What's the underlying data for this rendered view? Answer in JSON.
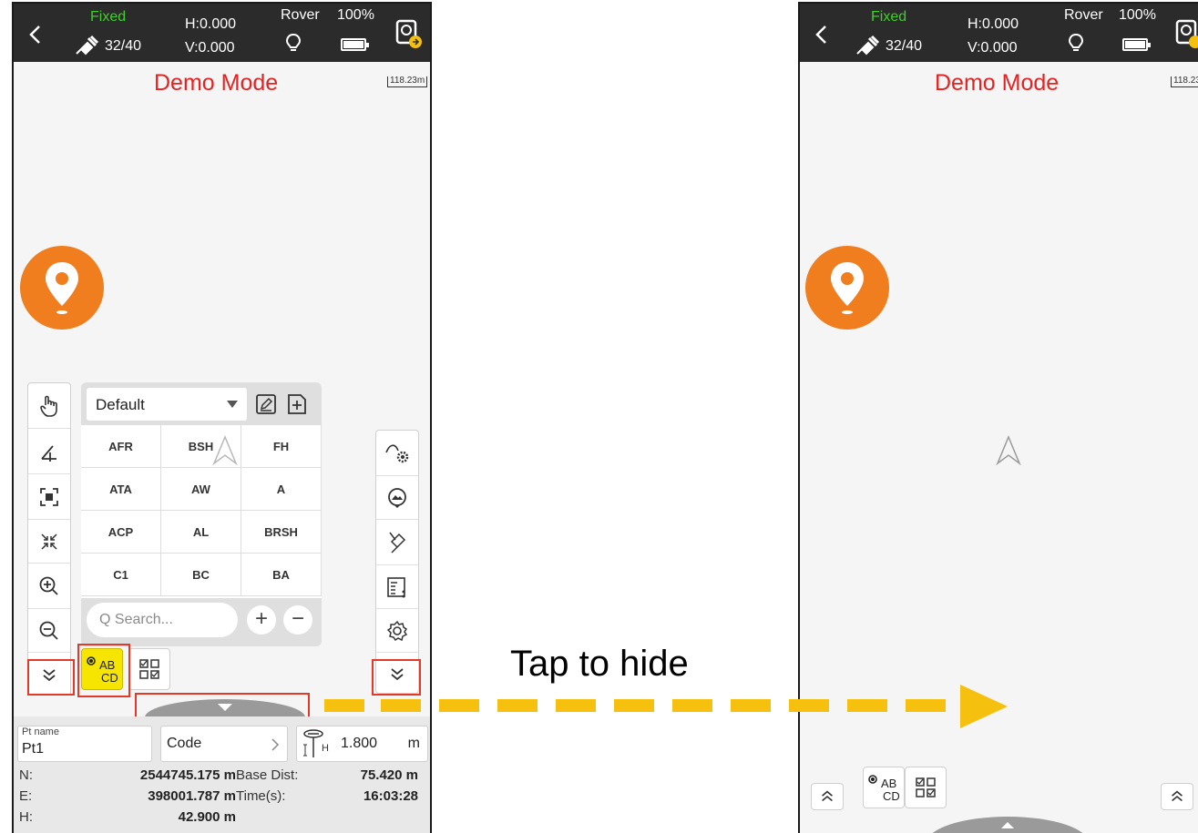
{
  "status": {
    "fix_label": "Fixed",
    "satellites": "32/40",
    "h_precision": "H:0.000",
    "v_precision": "V:0.000",
    "mode": "Rover",
    "battery": "100%"
  },
  "map": {
    "banner": "Demo Mode",
    "scale_a": "118.23m",
    "scale_b": "118.23"
  },
  "code_panel": {
    "library": "Default",
    "codes": [
      "AFR",
      "BSH",
      "FH",
      "ATA",
      "AW",
      "A",
      "ACP",
      "AL",
      "BRSH",
      "C1",
      "BC",
      "BA"
    ],
    "search_placeholder": "Q Search...",
    "add_label": "+",
    "remove_label": "−"
  },
  "mode_button": {
    "top": "AB",
    "bottom": "CD"
  },
  "point": {
    "name_label": "Pt name",
    "name_value": "Pt1",
    "code_label": "Code",
    "antenna_height": "1.800",
    "height_unit": "m",
    "height_suffix": "H"
  },
  "readings": {
    "n_label": "N:",
    "n_value": "2544745.175 m",
    "e_label": "E:",
    "e_value": "398001.787 m",
    "h_label": "H:",
    "h_value": "42.900 m",
    "base_label": "Base Dist:",
    "base_value": "75.420 m",
    "time_label": "Time(s):",
    "time_value": "16:03:28"
  },
  "annotation": {
    "caption": "Tap to hide",
    "arrow_color": "#f6c00e",
    "highlight_color": "#e23a2a"
  }
}
